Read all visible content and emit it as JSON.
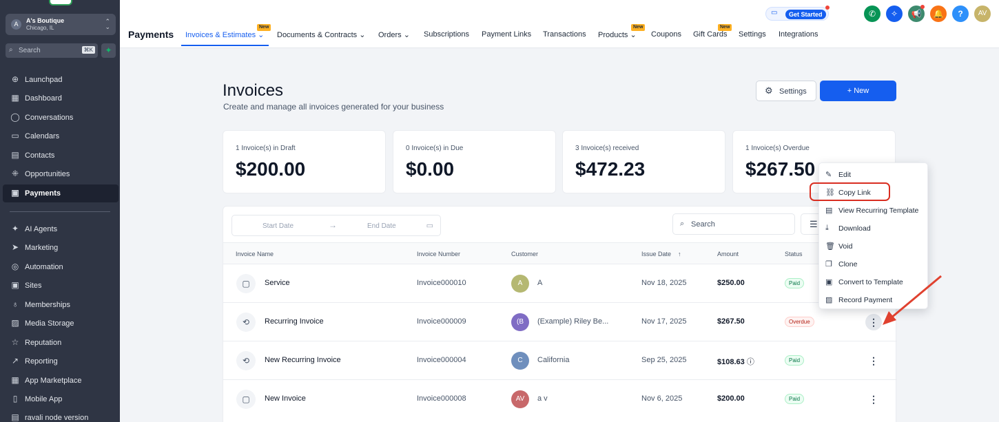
{
  "sidebar": {
    "location": {
      "avatar": "A",
      "name": "A's Boutique",
      "city": "Chicago, IL"
    },
    "search": {
      "placeholder": "Search",
      "shortcut": "⌘K"
    },
    "items": [
      {
        "label": "Launchpad",
        "icon": "⊕"
      },
      {
        "label": "Dashboard",
        "icon": "▦"
      },
      {
        "label": "Conversations",
        "icon": "◯"
      },
      {
        "label": "Calendars",
        "icon": "▭"
      },
      {
        "label": "Contacts",
        "icon": "▤"
      },
      {
        "label": "Opportunities",
        "icon": "⁜"
      },
      {
        "label": "Payments",
        "icon": "▣"
      },
      {
        "label": "AI Agents",
        "icon": "✦"
      },
      {
        "label": "Marketing",
        "icon": "➤"
      },
      {
        "label": "Automation",
        "icon": "◎"
      },
      {
        "label": "Sites",
        "icon": "▣"
      },
      {
        "label": "Memberships",
        "icon": "♁"
      },
      {
        "label": "Media Storage",
        "icon": "▨"
      },
      {
        "label": "Reputation",
        "icon": "☆"
      },
      {
        "label": "Reporting",
        "icon": "↗"
      },
      {
        "label": "App Marketplace",
        "icon": "▦"
      },
      {
        "label": "Mobile App",
        "icon": "▯"
      },
      {
        "label": "ravali node version",
        "icon": "▤"
      }
    ]
  },
  "topbar": {
    "title": "Payments",
    "new_badge": "New",
    "tabs": [
      {
        "label": "Invoices & Estimates"
      },
      {
        "label": "Documents & Contracts"
      },
      {
        "label": "Orders"
      },
      {
        "label": "Subscriptions"
      },
      {
        "label": "Payment Links"
      },
      {
        "label": "Transactions"
      },
      {
        "label": "Products"
      },
      {
        "label": "Coupons"
      },
      {
        "label": "Gift Cards"
      },
      {
        "label": "Settings"
      },
      {
        "label": "Integrations"
      }
    ],
    "get_started": "Get Started",
    "user_initials": "AV"
  },
  "page": {
    "title": "Invoices",
    "subtitle": "Create and manage all invoices generated for your business",
    "settings_button": "Settings",
    "new_button": "+ New"
  },
  "cards": [
    {
      "label": "1 Invoice(s) in Draft",
      "value": "$200.00"
    },
    {
      "label": "0 Invoice(s) in Due",
      "value": "$0.00"
    },
    {
      "label": "3 Invoice(s) received",
      "value": "$472.23"
    },
    {
      "label": "1 Invoice(s) Overdue",
      "value": "$267.50"
    }
  ],
  "filters": {
    "start_date": "Start Date",
    "end_date": "End Date",
    "search": "Search"
  },
  "table": {
    "headers": [
      "Invoice Name",
      "Invoice Number",
      "Customer",
      "Issue Date",
      "Amount",
      "Status"
    ],
    "rows": [
      {
        "name": "Service",
        "number": "Invoice000010",
        "avatar": "A",
        "customer": "A",
        "date": "Nov 18, 2025",
        "amount": "$250.00",
        "status": "Paid"
      },
      {
        "name": "Recurring Invoice",
        "number": "Invoice000009",
        "avatar": "(B",
        "customer": "(Example) Riley Be...",
        "date": "Nov 17, 2025",
        "amount": "$267.50",
        "status": "Overdue"
      },
      {
        "name": "New Recurring Invoice",
        "number": "Invoice000004",
        "avatar": "C",
        "customer": "California",
        "date": "Sep 25, 2025",
        "amount": "$108.63",
        "status": "Paid"
      },
      {
        "name": "New Invoice",
        "number": "Invoice000008",
        "avatar": "AV",
        "customer": "a v",
        "date": "Nov 6, 2025",
        "amount": "$200.00",
        "status": "Paid"
      }
    ]
  },
  "menu": {
    "items": [
      {
        "label": "Edit",
        "icon": "✎"
      },
      {
        "label": "Copy Link",
        "icon": "⛓"
      },
      {
        "label": "View Recurring Template",
        "icon": "▤"
      },
      {
        "label": "Download",
        "icon": "⤓"
      },
      {
        "label": "Void",
        "icon": "🗑"
      },
      {
        "label": "Clone",
        "icon": "❐"
      },
      {
        "label": "Convert to Template",
        "icon": "▣"
      },
      {
        "label": "Record Payment",
        "icon": "▨"
      }
    ]
  },
  "colors": {
    "accent": "#155eef",
    "sidebar": "#2f3544",
    "highlight": "#d92d20"
  }
}
